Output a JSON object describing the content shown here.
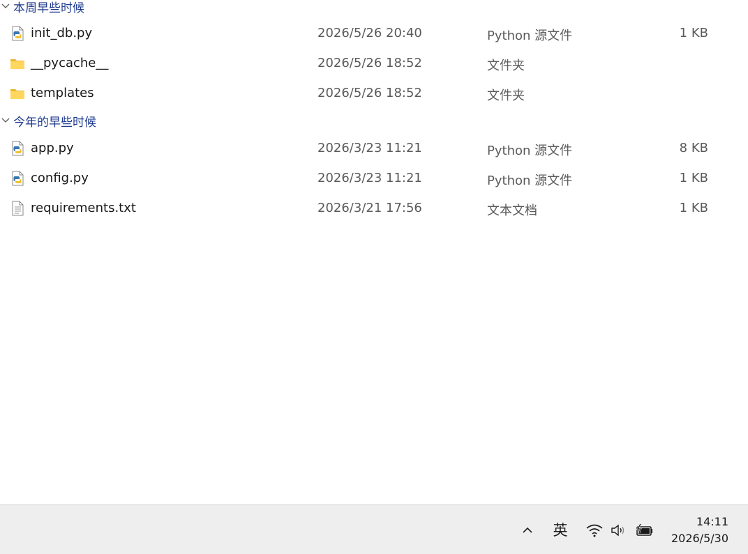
{
  "groups": [
    {
      "label": "本周早些时候",
      "files": [
        {
          "name": "init_db.py",
          "date": "2026/5/26 20:40",
          "type": "Python 源文件",
          "size": "1 KB",
          "icon": "python-file-icon"
        },
        {
          "name": "__pycache__",
          "date": "2026/5/26 18:52",
          "type": "文件夹",
          "size": "",
          "icon": "folder-icon"
        },
        {
          "name": "templates",
          "date": "2026/5/26 18:52",
          "type": "文件夹",
          "size": "",
          "icon": "folder-icon"
        }
      ]
    },
    {
      "label": "今年的早些时候",
      "files": [
        {
          "name": "app.py",
          "date": "2026/3/23 11:21",
          "type": "Python 源文件",
          "size": "8 KB",
          "icon": "python-file-icon"
        },
        {
          "name": "config.py",
          "date": "2026/3/23 11:21",
          "type": "Python 源文件",
          "size": "1 KB",
          "icon": "python-file-icon"
        },
        {
          "name": "requirements.txt",
          "date": "2026/3/21 17:56",
          "type": "文本文档",
          "size": "1 KB",
          "icon": "text-file-icon"
        }
      ]
    }
  ],
  "taskbar": {
    "ime": "英",
    "time": "14:11",
    "date": "2026/5/30",
    "icons": [
      "chevron-up-icon",
      "wifi-icon",
      "speaker-icon",
      "battery-charging-icon"
    ]
  },
  "colors": {
    "group_header": "#1f3b8f",
    "secondary_text": "#5a5a5a",
    "taskbar_bg": "#eeeeee"
  }
}
